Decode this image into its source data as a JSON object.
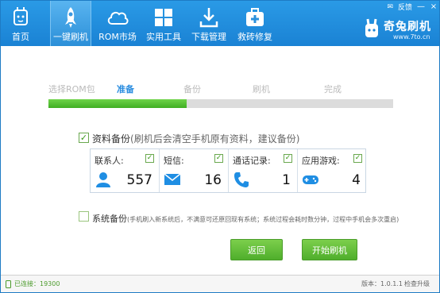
{
  "nav": [
    {
      "label": "首页",
      "icon": "home-rabbit-icon"
    },
    {
      "label": "一键刷机",
      "icon": "rocket-icon"
    },
    {
      "label": "ROM市场",
      "icon": "cloud-icon"
    },
    {
      "label": "实用工具",
      "icon": "grid-icon"
    },
    {
      "label": "下载管理",
      "icon": "download-icon"
    },
    {
      "label": "救砖修复",
      "icon": "first-aid-icon"
    }
  ],
  "window": {
    "feedback": "反馈",
    "min": "—",
    "close": "×"
  },
  "brand": {
    "name": "奇兔刷机",
    "site": "www.7to.cn"
  },
  "steps": [
    "选择ROM包",
    "准备",
    "备份",
    "刷机",
    "完成"
  ],
  "progress": {
    "fraction": 0.4
  },
  "backup": {
    "label": "资料备份",
    "hint": "(刷机后会清空手机原有资料，建议备份)",
    "items": [
      {
        "name": "联系人:",
        "count": "557",
        "icon": "contact-icon"
      },
      {
        "name": "短信:",
        "count": "16",
        "icon": "sms-envelope-icon"
      },
      {
        "name": "通话记录:",
        "count": "1",
        "icon": "phone-icon"
      },
      {
        "name": "应用游戏:",
        "count": "4",
        "icon": "gamepad-icon"
      }
    ]
  },
  "system_backup": {
    "label": "系统备份",
    "hint": "(手机刷入新系统后，不满意可还原回现有系统；系统过程会耗时数分钟，过程中手机会多次重启)"
  },
  "buttons": {
    "back": "返回",
    "start": "开始刷机"
  },
  "status": {
    "connection": "已连接：19300",
    "version": "版本：1.0.1.1",
    "upgrade": "检查升级"
  },
  "colors": {
    "header": "#1a82d4",
    "accent": "#2a8de0",
    "green": "#4fae2b"
  }
}
